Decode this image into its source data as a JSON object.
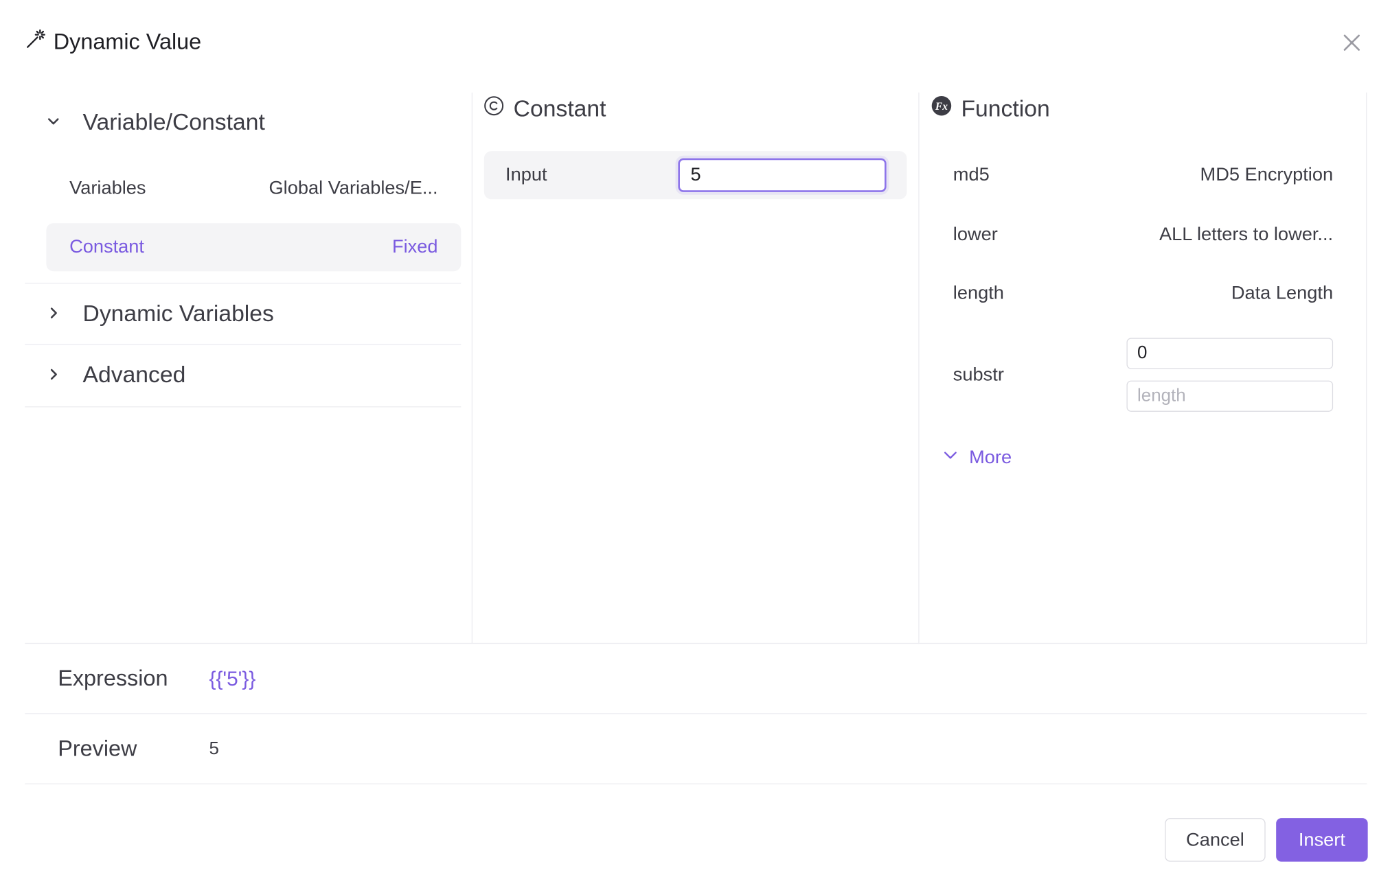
{
  "dialog": {
    "title": "Dynamic Value",
    "title_icon": "magic-wand-icon",
    "close_icon": "close-icon"
  },
  "left_panel": {
    "groups": [
      {
        "label": "Variable/Constant",
        "expanded": true,
        "items": [
          {
            "label": "Variables",
            "desc": "Global Variables/E...",
            "active": false
          },
          {
            "label": "Constant",
            "desc": "Fixed",
            "active": true
          }
        ]
      },
      {
        "label": "Dynamic Variables",
        "expanded": false
      },
      {
        "label": "Advanced",
        "expanded": false
      }
    ]
  },
  "constant_panel": {
    "title": "Constant",
    "icon": "copyright-icon",
    "input_label": "Input",
    "input_value": "5"
  },
  "function_panel": {
    "title": "Function",
    "icon": "function-fx-icon",
    "functions": [
      {
        "name": "md5",
        "desc": "MD5 Encryption"
      },
      {
        "name": "lower",
        "desc": "ALL letters to lower..."
      },
      {
        "name": "length",
        "desc": "Data Length"
      }
    ],
    "substr": {
      "name": "substr",
      "start_value": "0",
      "length_placeholder": "length"
    },
    "more_label": "More"
  },
  "expression": {
    "label": "Expression",
    "value": "{{'5'}}"
  },
  "preview": {
    "label": "Preview",
    "value": "5"
  },
  "buttons": {
    "cancel": "Cancel",
    "insert": "Insert"
  },
  "colors": {
    "accent": "#7a5ae0",
    "primary_button": "#8361e2",
    "active_row_bg": "#f4f4f6",
    "divider": "#ececf0"
  }
}
